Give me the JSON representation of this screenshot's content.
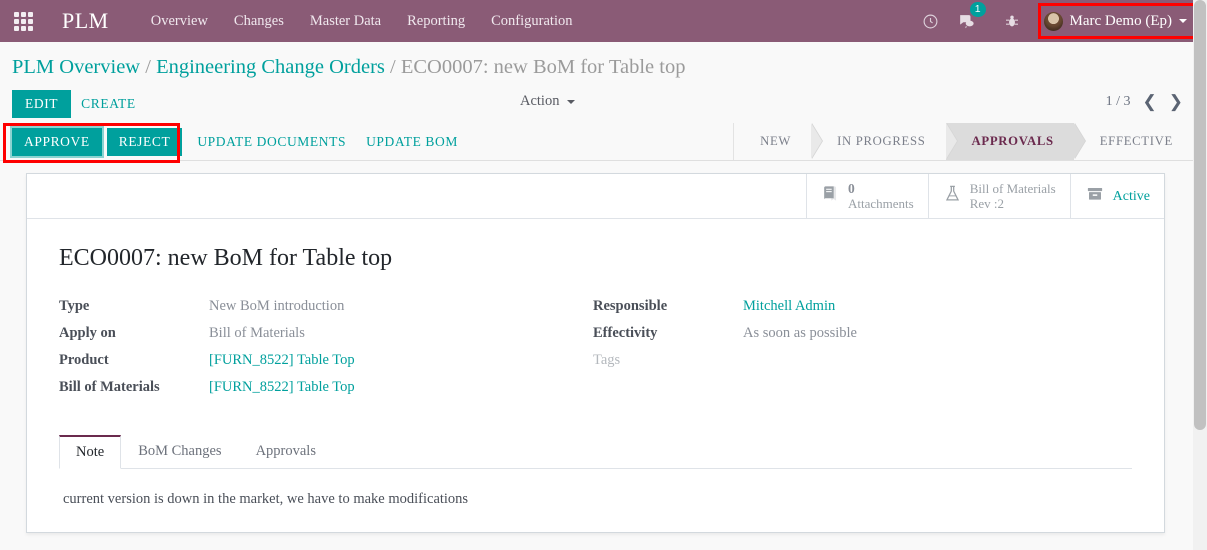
{
  "navbar": {
    "apps_icon": "apps-grid-icon",
    "brand": "PLM",
    "menu": [
      {
        "label": "Overview"
      },
      {
        "label": "Changes"
      },
      {
        "label": "Master Data"
      },
      {
        "label": "Reporting"
      },
      {
        "label": "Configuration"
      }
    ],
    "clock_icon": "clock-icon",
    "chat_icon": "chat-bubble-icon",
    "chat_badge": "1",
    "bug_icon": "bug-icon",
    "user_name": "Marc Demo (Ep)",
    "accent_purple": "#8a5b76",
    "accent_teal": "#00a09d"
  },
  "breadcrumb": {
    "root": "PLM Overview",
    "sep1": "/",
    "parent": "Engineering Change Orders",
    "sep2": "/",
    "current": "ECO0007: new BoM for Table top"
  },
  "control_panel": {
    "edit_label": "EDIT",
    "create_label": "CREATE",
    "action_label": "Action",
    "pager_text": "1 / 3",
    "prev_icon": "chevron-left-icon",
    "next_icon": "chevron-right-icon"
  },
  "action_bar": {
    "buttons": [
      {
        "label": "APPROVE",
        "style": "primary"
      },
      {
        "label": "REJECT",
        "style": "primary"
      },
      {
        "label": "UPDATE DOCUMENTS",
        "style": "link"
      },
      {
        "label": "UPDATE BOM",
        "style": "link"
      }
    ]
  },
  "statusbar": {
    "stages": [
      {
        "label": "NEW",
        "active": false
      },
      {
        "label": "IN PROGRESS",
        "active": false
      },
      {
        "label": "APPROVALS",
        "active": true
      },
      {
        "label": "EFFECTIVE",
        "active": false
      }
    ]
  },
  "stat_buttons": [
    {
      "icon": "book-icon",
      "value": "0",
      "label": "Attachments"
    },
    {
      "icon": "flask-icon",
      "line1": "Bill of Materials",
      "line2": "Rev :2"
    },
    {
      "icon": "archive-box-icon",
      "label": "Active"
    }
  ],
  "record": {
    "title": "ECO0007: new BoM for Table top",
    "left_fields": [
      {
        "label": "Type",
        "value": "New BoM introduction",
        "link": false
      },
      {
        "label": "Apply on",
        "value": "Bill of Materials",
        "link": false
      },
      {
        "label": "Product",
        "value": "[FURN_8522] Table Top",
        "link": true
      },
      {
        "label": "Bill of Materials",
        "value": "[FURN_8522] Table Top",
        "link": true
      }
    ],
    "right_fields": [
      {
        "label": "Responsible",
        "value": "Mitchell Admin",
        "link": true
      },
      {
        "label": "Effectivity",
        "value": "As soon as possible",
        "link": false
      },
      {
        "label": "Tags",
        "value": "",
        "link": false,
        "muted": true
      }
    ]
  },
  "notebook": {
    "tabs": [
      {
        "label": "Note",
        "active": true
      },
      {
        "label": "BoM Changes",
        "active": false
      },
      {
        "label": "Approvals",
        "active": false
      }
    ],
    "note_text": "current version is down in the market, we have to make modifications"
  },
  "annotations": {
    "user_menu_highlight": "red-box-user-menu",
    "approve_reject_highlight": "red-box-approve-reject",
    "color": "#fe0000"
  }
}
